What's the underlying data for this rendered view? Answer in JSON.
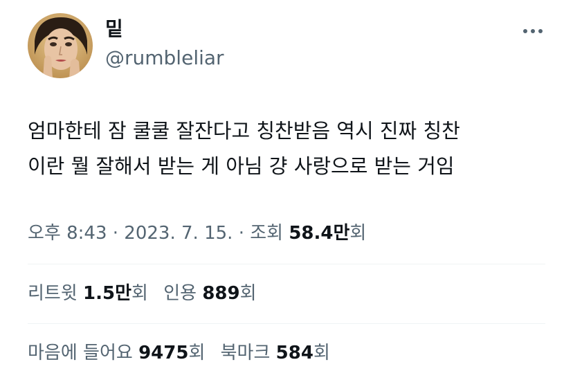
{
  "user": {
    "display_name": "밑",
    "handle": "@rumbleliar",
    "avatar": "profile-photo"
  },
  "tweet": {
    "text_line_1": "엄마한테 잠 쿨쿨 잘잔다고 칭찬받음 역시 진짜 칭찬",
    "text_line_2": "이란 뭘 잘해서 받는 게 아님 걍 사랑으로 받는 거임"
  },
  "meta": {
    "time": "오후 8:43",
    "separator": "·",
    "date": "2023. 7. 15.",
    "views_label": "조회",
    "views_value": "58.4만",
    "views_suffix": "회"
  },
  "stats": {
    "retweets_label": "리트윗",
    "retweets_value": "1.5만",
    "retweets_suffix": "회",
    "quotes_label": "인용",
    "quotes_value": "889",
    "quotes_suffix": "회",
    "likes_label": "마음에 들어요",
    "likes_value": "9475",
    "likes_suffix": "회",
    "bookmarks_label": "북마크",
    "bookmarks_value": "584",
    "bookmarks_suffix": "회"
  },
  "icons": {
    "more": "more-horizontal-icon"
  },
  "colors": {
    "text_primary": "#0f1419",
    "text_secondary": "#536471",
    "divider": "#eff3f4"
  }
}
